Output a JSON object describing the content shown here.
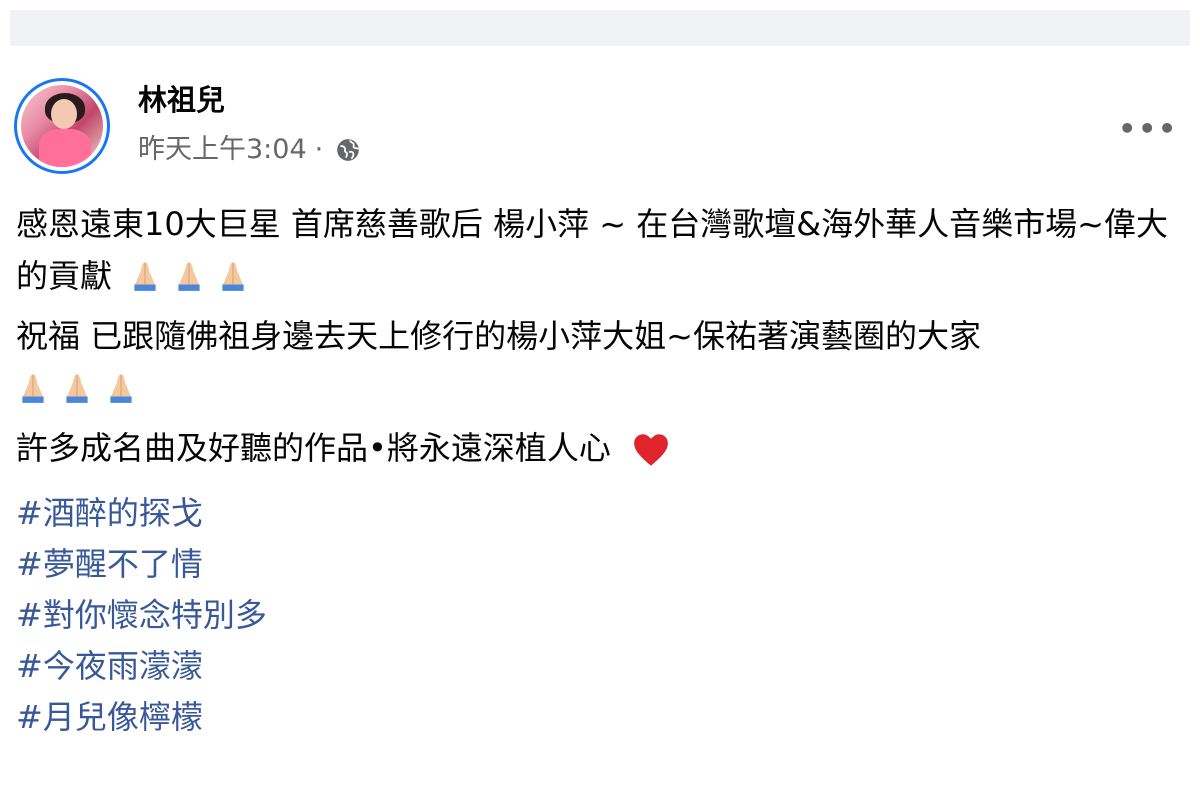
{
  "post": {
    "author": "林祖兒",
    "timestamp": "昨天上午3:04",
    "separator": "·",
    "privacy_icon": "globe-icon",
    "more_icon": "more-options-icon",
    "paragraphs": {
      "p1": "感恩遠東10大巨星 首席慈善歌后 楊小萍 ~ 在台灣歌壇&海外華人音樂市場~偉大的貢獻",
      "p2": "祝福 已跟隨佛祖身邊去天上修行的楊小萍大姐~保祐著演藝圈的大家",
      "p3": "許多成名曲及好聽的作品•將永遠深植人心"
    },
    "emoji": {
      "pray": "folded-hands-icon",
      "heart": "red-heart-icon"
    },
    "hashtags": [
      "#酒醉的探戈",
      "#夢醒不了情",
      "#對你懷念特別多",
      "#今夜雨濛濛",
      "#月兒像檸檬"
    ]
  },
  "colors": {
    "link": "#385898",
    "muted": "#65676b",
    "avatar_ring": "#1877f2",
    "heart": "#e0242c"
  }
}
